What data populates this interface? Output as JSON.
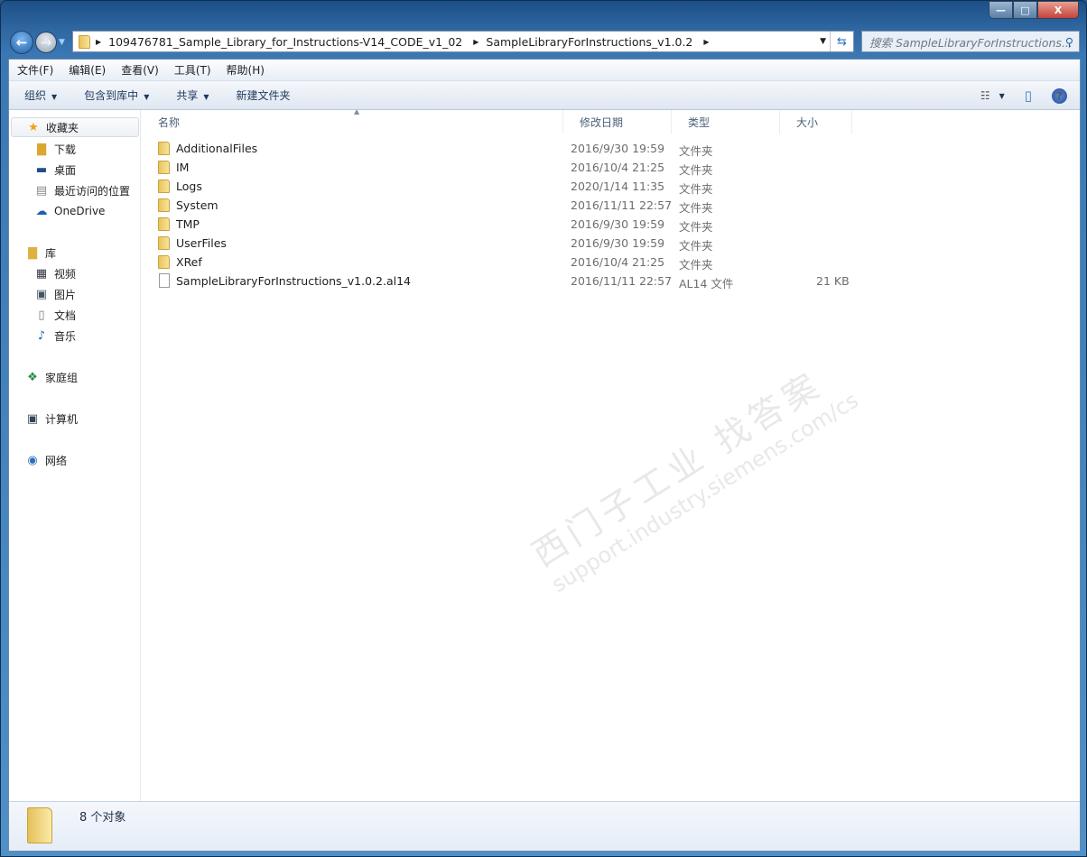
{
  "window": {
    "minimize": "—",
    "maximize": "□",
    "close": "X"
  },
  "nav": {
    "back_icon": "←",
    "forward_icon": "→"
  },
  "address": {
    "segments": [
      "109476781_Sample_Library_for_Instructions-V14_CODE_v1_02",
      "SampleLibraryForInstructions_v1.0.2"
    ]
  },
  "search": {
    "placeholder": "搜索 SampleLibraryForInstructions..."
  },
  "menu": [
    "文件(F)",
    "编辑(E)",
    "查看(V)",
    "工具(T)",
    "帮助(H)"
  ],
  "toolbar": {
    "organize": "组织",
    "include_library": "包含到库中",
    "share": "共享",
    "new_folder": "新建文件夹"
  },
  "sidebar": {
    "favorites": "收藏夹",
    "fav_items": [
      "下载",
      "桌面",
      "最近访问的位置",
      "OneDrive"
    ],
    "libraries": "库",
    "lib_items": [
      "视频",
      "图片",
      "文档",
      "音乐"
    ],
    "homegroup": "家庭组",
    "computer": "计算机",
    "network": "网络"
  },
  "columns": {
    "name": "名称",
    "modified": "修改日期",
    "type": "类型",
    "size": "大小"
  },
  "files": [
    {
      "name": "AdditionalFiles",
      "modified": "2016/9/30 19:59",
      "type": "文件夹",
      "size": "",
      "kind": "folder"
    },
    {
      "name": "IM",
      "modified": "2016/10/4 21:25",
      "type": "文件夹",
      "size": "",
      "kind": "folder"
    },
    {
      "name": "Logs",
      "modified": "2020/1/14 11:35",
      "type": "文件夹",
      "size": "",
      "kind": "folder"
    },
    {
      "name": "System",
      "modified": "2016/11/11 22:57",
      "type": "文件夹",
      "size": "",
      "kind": "folder"
    },
    {
      "name": "TMP",
      "modified": "2016/9/30 19:59",
      "type": "文件夹",
      "size": "",
      "kind": "folder"
    },
    {
      "name": "UserFiles",
      "modified": "2016/9/30 19:59",
      "type": "文件夹",
      "size": "",
      "kind": "folder"
    },
    {
      "name": "XRef",
      "modified": "2016/10/4 21:25",
      "type": "文件夹",
      "size": "",
      "kind": "folder"
    },
    {
      "name": "SampleLibraryForInstructions_v1.0.2.al14",
      "modified": "2016/11/11 22:57",
      "type": "AL14 文件",
      "size": "21 KB",
      "kind": "file"
    }
  ],
  "watermark": {
    "line1": "西门子工业  找答案",
    "line2": "support.industry.siemens.com/cs"
  },
  "status": {
    "count": "8 个对象"
  }
}
